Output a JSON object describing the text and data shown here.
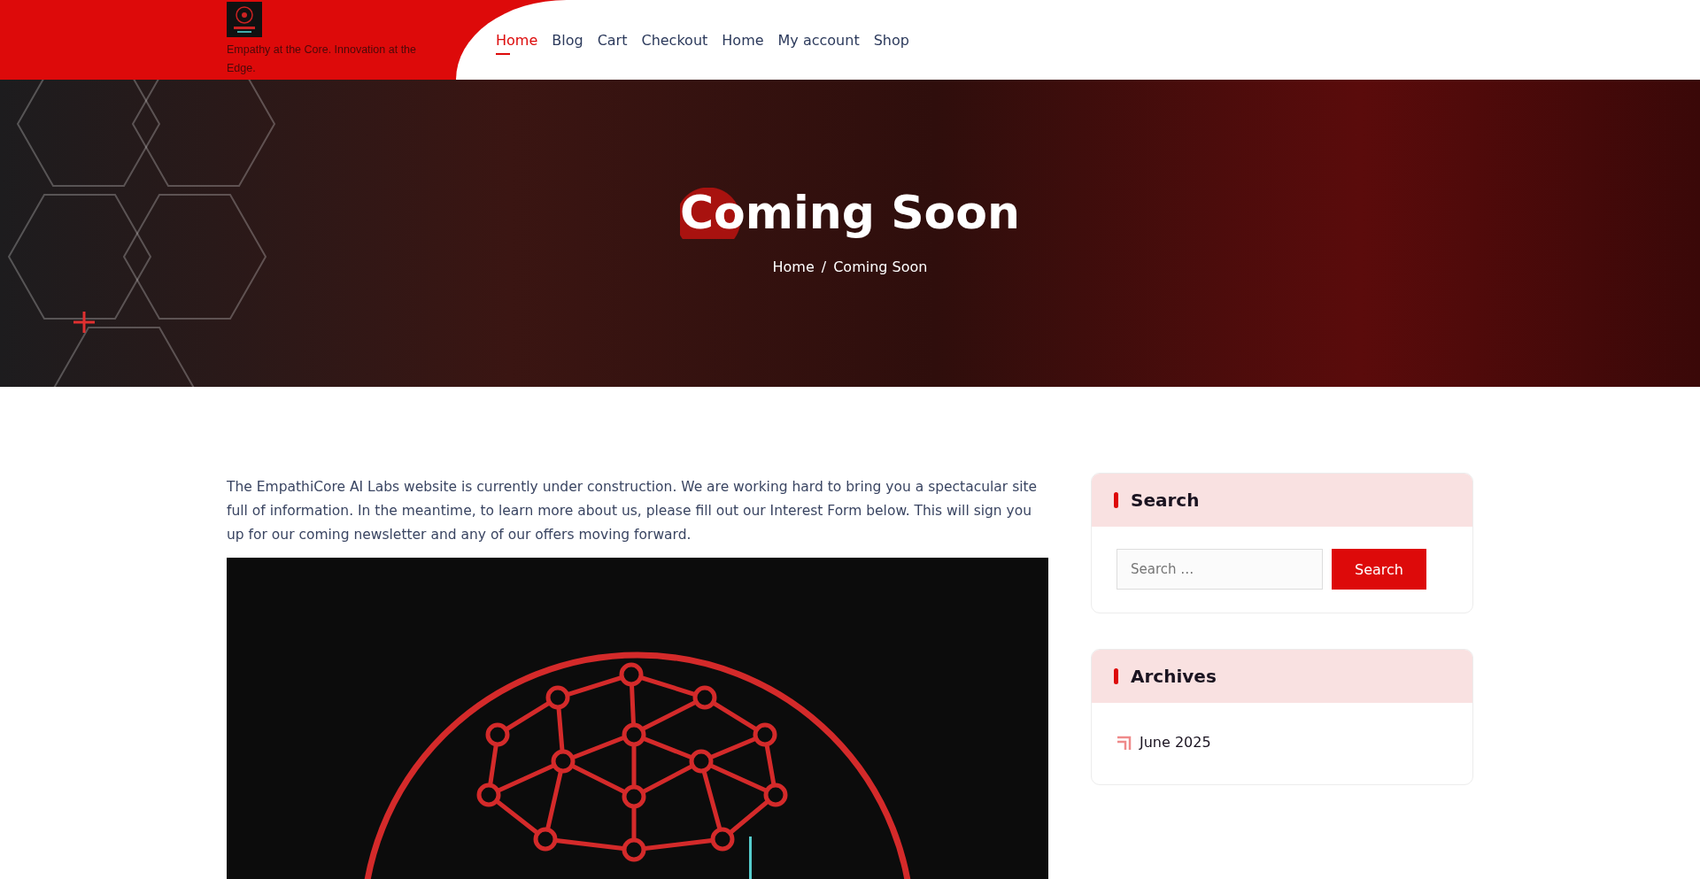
{
  "header": {
    "tagline": "Empathy at the Core. Innovation at the Edge.",
    "nav": [
      {
        "label": "Home",
        "selected": true
      },
      {
        "label": "Blog",
        "selected": false
      },
      {
        "label": "Cart",
        "selected": false
      },
      {
        "label": "Checkout",
        "selected": false
      },
      {
        "label": "Home",
        "selected": false
      },
      {
        "label": "My account",
        "selected": false
      },
      {
        "label": "Shop",
        "selected": false
      }
    ]
  },
  "hero": {
    "title": "Coming Soon",
    "breadcrumb": [
      "Home",
      "Coming Soon"
    ],
    "separator": "/"
  },
  "main": {
    "paragraph": "The EmpathiCore AI Labs website is currently under construction. We are working hard to bring you a spectacular site full of information. In the meantime, to learn more about us, please fill out our Interest Form below. This will sign you up for our coming newsletter and any of our offers moving forward."
  },
  "sidebar": {
    "search": {
      "title": "Search",
      "placeholder": "Search …",
      "button": "Search"
    },
    "archives": {
      "title": "Archives",
      "items": [
        "June 2025"
      ]
    }
  }
}
